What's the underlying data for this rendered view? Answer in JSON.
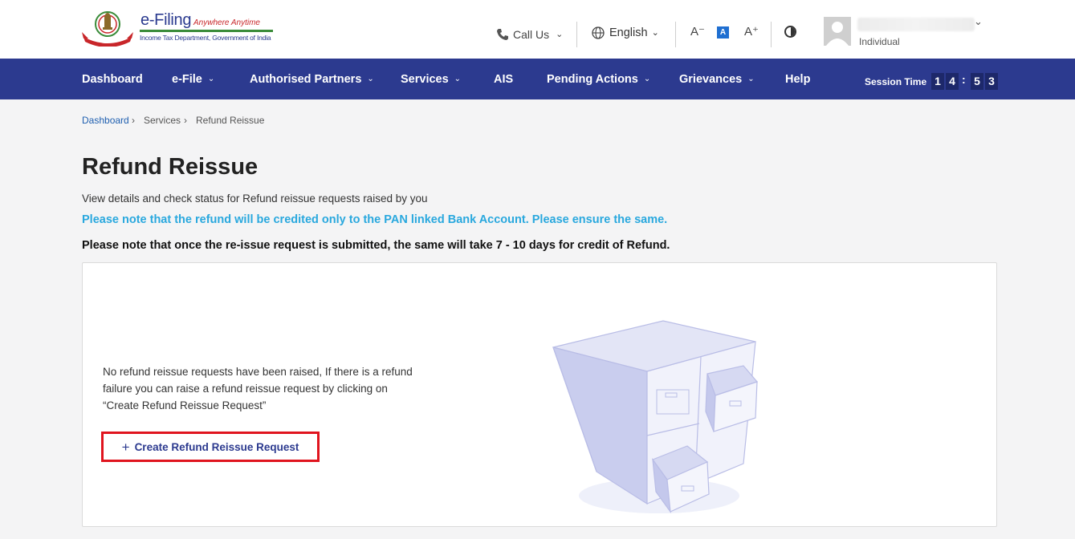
{
  "header": {
    "logo_title": "e-Filing",
    "logo_tagline": "Anywhere Anytime",
    "logo_subtitle": "Income Tax Department, Government of India",
    "call_us": "Call Us",
    "language": "English",
    "font_decrease": "A⁻",
    "font_default": "A",
    "font_increase": "A⁺",
    "user_role": "Individual"
  },
  "nav": {
    "items": [
      {
        "label": "Dashboard",
        "has_dropdown": false
      },
      {
        "label": "e-File",
        "has_dropdown": true
      },
      {
        "label": "Authorised Partners",
        "has_dropdown": true
      },
      {
        "label": "Services",
        "has_dropdown": true
      },
      {
        "label": "AIS",
        "has_dropdown": false
      },
      {
        "label": "Pending Actions",
        "has_dropdown": true
      },
      {
        "label": "Grievances",
        "has_dropdown": true
      },
      {
        "label": "Help",
        "has_dropdown": false
      }
    ],
    "session_label": "Session Time",
    "session_digits": [
      "1",
      "4",
      "5",
      "3"
    ]
  },
  "breadcrumb": {
    "items": [
      "Dashboard",
      "Services",
      "Refund Reissue"
    ]
  },
  "page": {
    "title": "Refund Reissue",
    "description": "View details and check status for Refund reissue requests raised by you",
    "note_blue": "Please note that the refund will be credited only to the PAN linked Bank Account. Please ensure the same.",
    "note_black": "Please note that once the re-issue request is submitted, the same will take 7 - 10 days for credit of Refund."
  },
  "empty_state": {
    "message": "No refund reissue requests have been raised, If there is a refund failure you can raise a refund reissue request by clicking on “Create Refund Reissue Request”",
    "button_label": "Create Refund Reissue Request",
    "button_icon": "plus-icon"
  },
  "colors": {
    "nav_bg": "#2c3a8f",
    "note_blue": "#29a8de",
    "highlight_border": "#e0141e"
  }
}
